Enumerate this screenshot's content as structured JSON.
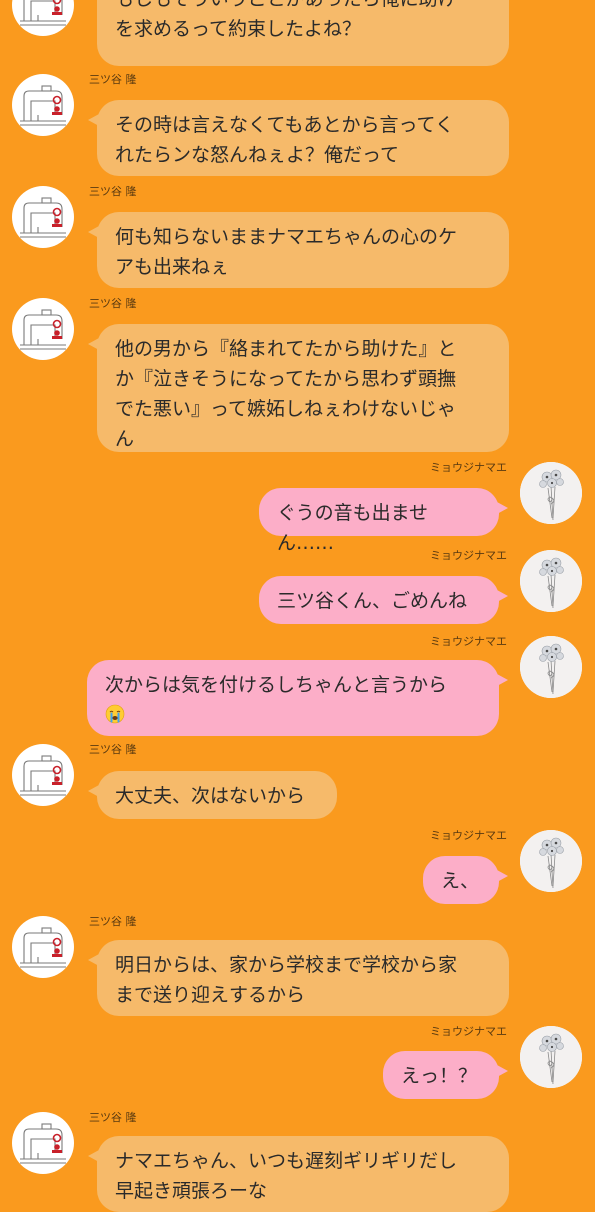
{
  "chat": {
    "contacts": {
      "mitsuya": {
        "name": "三ツ谷 隆",
        "avatar_icon": "sewing-machine-icon"
      },
      "me": {
        "name": "ミョウジナマエ",
        "avatar_icon": "flower-bouquet-icon"
      }
    },
    "colors": {
      "background": "#fa9a1e",
      "incoming_bubble": "#f6ba6a",
      "outgoing_bubble": "#fcaec8"
    },
    "messages": [
      {
        "from": "mitsuya",
        "text": "もしもそういうことがあったら俺に助け\nを求めるって約束したよね？"
      },
      {
        "from": "mitsuya",
        "name": "三ツ谷 隆",
        "text": "その時は言えなくてもあとから言ってく\nれたらンな怒んねぇよ？俺だって"
      },
      {
        "from": "mitsuya",
        "name": "三ツ谷 隆",
        "text": "何も知らないままナマエちゃんの心のケ\nアも出来ねぇ"
      },
      {
        "from": "mitsuya",
        "name": "三ツ谷 隆",
        "text": "他の男から『絡まれてたから助けた』と\nか『泣きそうになってたから思わず頭撫\nでた悪い』って嫉妬しねぇわけないじゃ\nん"
      },
      {
        "from": "me",
        "name": "ミョウジナマエ",
        "text": "ぐうの音も出ません……"
      },
      {
        "from": "me",
        "name": "ミョウジナマエ",
        "text": "三ツ谷くん、ごめんね"
      },
      {
        "from": "me",
        "name": "ミョウジナマエ",
        "text": "次からは気を付けるしちゃんと言うから",
        "emoji": "crying-face-emoji"
      },
      {
        "from": "mitsuya",
        "name": "三ツ谷 隆",
        "text": "大丈夫、次はないから"
      },
      {
        "from": "me",
        "name": "ミョウジナマエ",
        "text": "え、"
      },
      {
        "from": "mitsuya",
        "name": "三ツ谷 隆",
        "text": "明日からは、家から学校まで学校から家\nまで送り迎えするから"
      },
      {
        "from": "me",
        "name": "ミョウジナマエ",
        "text": "えっ！？"
      },
      {
        "from": "mitsuya",
        "name": "三ツ谷 隆",
        "text": "ナマエちゃん、いつも遅刻ギリギリだし\n早起き頑張ろーな"
      }
    ]
  }
}
